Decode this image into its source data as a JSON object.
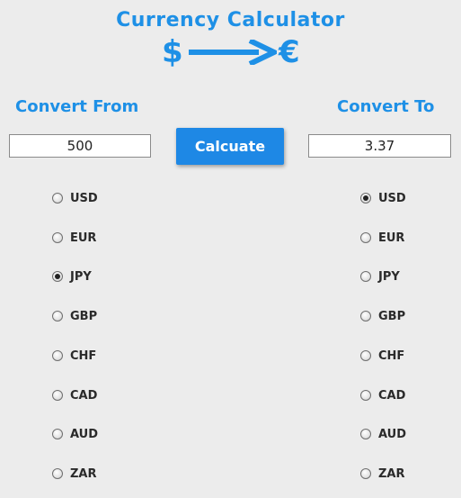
{
  "app": {
    "title": "Currency Calculator",
    "logo_from_symbol": "$",
    "logo_to_symbol": "€",
    "accent_color": "#1e90e6"
  },
  "from": {
    "label": "Convert From",
    "amount": "500",
    "selected": "JPY",
    "options": [
      "USD",
      "EUR",
      "JPY",
      "GBP",
      "CHF",
      "CAD",
      "AUD",
      "ZAR"
    ]
  },
  "to": {
    "label": "Convert To",
    "amount": "3.37",
    "selected": "USD",
    "options": [
      "USD",
      "EUR",
      "JPY",
      "GBP",
      "CHF",
      "CAD",
      "AUD",
      "ZAR"
    ]
  },
  "calculate_button": {
    "label": "Calcuate"
  }
}
